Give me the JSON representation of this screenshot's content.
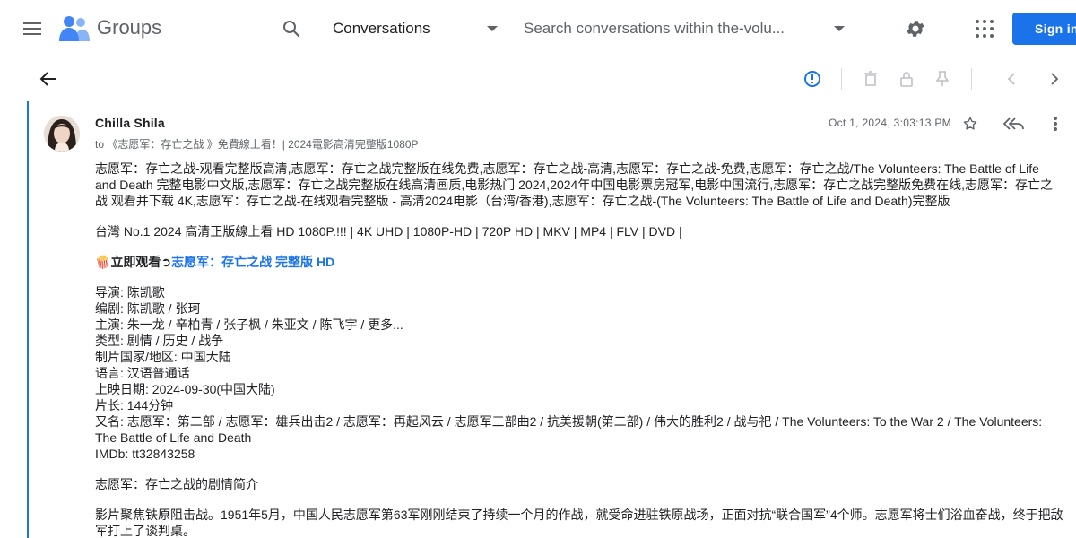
{
  "app": {
    "logo_text": "Groups",
    "scope": "Conversations",
    "search_placeholder": "Search conversations within the-volu...",
    "signin_label": "Sign in",
    "accent": "#1a73e8"
  },
  "toolbar": {
    "icons": [
      "back-arrow-icon",
      "info-icon",
      "delete-icon",
      "lock-icon",
      "pin-icon",
      "chevron-left-icon",
      "chevron-right-icon"
    ]
  },
  "message": {
    "sender": "Chilla Shila",
    "to_prefix": "to",
    "to": "《志愿军：存亡之战 》免費線上看！| 2024電影高清完整版1080P",
    "timestamp": "Oct 1, 2024, 3:03:13 PM",
    "paragraph1": "志愿军：存亡之战-观看完整版高清,志愿军：存亡之战完整版在线免费,志愿军：存亡之战-高清,志愿军：存亡之战-免费,志愿军：存亡之战/The Volunteers: The Battle of Life and Death 完整电影中文版,志愿军：存亡之战完整版在线高清画质,电影热门 2024,2024年中国电影票房冠军,电影中国流行,志愿军：存亡之战完整版免费在线,志愿军：存亡之战 观看并下载 4K,志愿军：存亡之战-在线观看完整版 - 高清2024电影（台湾/香港),志愿军：存亡之战-(The Volunteers: The Battle of Life and Death)完整版",
    "paragraph2": "台灣 No.1 2024 高清正版線上看 HD 1080P.!!! | 4K UHD | 1080P-HD | 720P HD | MKV | MP4 | FLV | DVD |",
    "watch_emoji": "🍿",
    "watch_label": "立即观看➲",
    "watch_link": "志愿军：存亡之战 完整版 HD",
    "details": [
      "导演: 陈凯歌",
      "编剧: 陈凯歌 / 张珂",
      "主演: 朱一龙 / 辛柏青 / 张子枫 / 朱亚文 / 陈飞宇 / 更多...",
      "类型: 剧情 / 历史 / 战争",
      "制片国家/地区: 中国大陆",
      "语言: 汉语普通话",
      "上映日期: 2024-09-30(中国大陆)",
      "片长: 144分钟",
      "又名: 志愿军：第二部 / 志愿军：雄兵出击2 / 志愿军：再起风云 / 志愿军三部曲2 / 抗美援朝(第二部) / 伟大的胜利2 / 战与祀 / The Volunteers: To the War 2 / The Volunteers: The Battle of Life and Death",
      "IMDb: tt32843258"
    ],
    "synopsis_heading": "志愿军：存亡之战的剧情简介",
    "synopsis": "影片聚焦铁原阻击战。1951年5月，中国人民志愿军第63军刚刚结束了持续一个月的作战，就受命进驻铁原战场，正面对抗“联合国军”4个师。志愿军将士们浴血奋战，终于把敌军打上了谈判桌。"
  }
}
